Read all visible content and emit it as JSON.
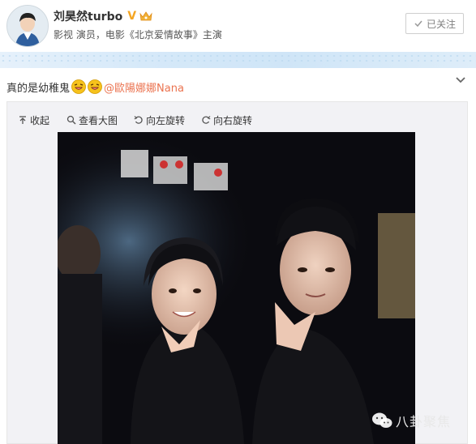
{
  "profile": {
    "username": "刘昊然turbo",
    "verified_mark": "V",
    "bio": "影视 演员，电影《北京爱情故事》主演",
    "follow_button_label": "已关注"
  },
  "post": {
    "text": "真的是幼稚鬼",
    "mention": "@歐陽娜娜Nana",
    "emoji_icon": "laughing-face-icon"
  },
  "media_toolbar": {
    "items": [
      {
        "label": "收起",
        "icon": "collapse-up-icon"
      },
      {
        "label": "查看大图",
        "icon": "zoom-search-icon"
      },
      {
        "label": "向左旋转",
        "icon": "rotate-left-icon"
      },
      {
        "label": "向右旋转",
        "icon": "rotate-right-icon"
      }
    ]
  },
  "watermark": {
    "text": "八卦聚焦",
    "icon": "wechat-icon"
  },
  "colors": {
    "mention": "#eb7350",
    "verified": "#f5a623",
    "band": "#d6e9f9",
    "panel_bg": "#f2f2f5"
  }
}
